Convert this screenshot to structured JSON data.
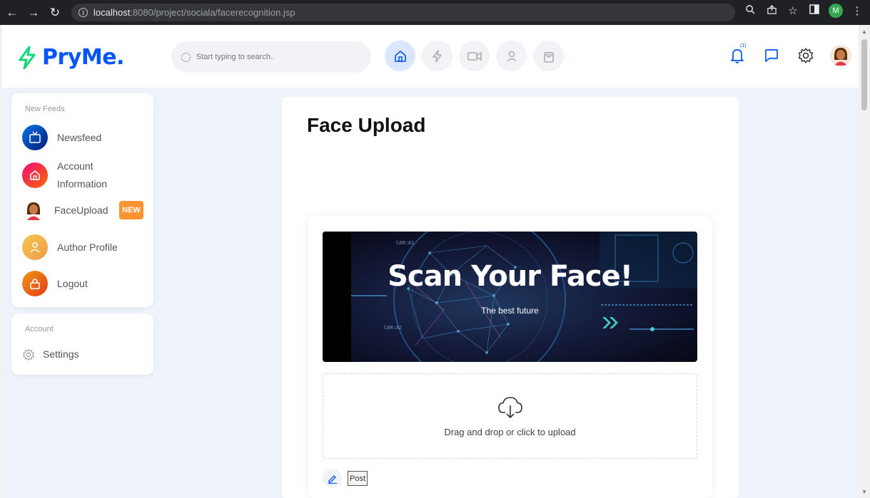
{
  "browser": {
    "url_host": "localhost",
    "url_path": ":8080/project/sociala/facerecognition.jsp",
    "profile_initial": "M",
    "icons": [
      "back-icon",
      "forward-icon",
      "reload-icon",
      "zoom-icon",
      "share-icon",
      "star-icon",
      "sidepanel-icon",
      "menu-icon"
    ]
  },
  "header": {
    "logo_text": "PryMe.",
    "search_placeholder": "Start typing to search..",
    "nav_icons": [
      "home-icon",
      "bolt-icon",
      "video-icon",
      "user-icon",
      "bag-icon"
    ],
    "notification_count": "(1)"
  },
  "sidebar": {
    "section1_title": "New Feeds",
    "items": [
      {
        "label": "Newsfeed",
        "icon": "tv-icon",
        "color": "#0055ff"
      },
      {
        "label": "Account",
        "label2": "Information",
        "icon": "home-icon",
        "color": "#ee0979"
      },
      {
        "label": "FaceUpload",
        "icon": "face-avatar-icon"
      },
      {
        "label": "Author Profile",
        "icon": "user-icon",
        "color": "#f2994a"
      },
      {
        "label": "Logout",
        "icon": "lock-icon",
        "color": "#e44d26"
      }
    ],
    "new_badge": "NEW",
    "section2_title": "Account",
    "settings_label": "Settings"
  },
  "main": {
    "title": "Face Upload",
    "banner_title": "Scan Your Face!",
    "banner_subtitle": "The best future",
    "drop_text": "Drag and drop or click to upload",
    "post_label": "Post"
  },
  "colors": {
    "brand_blue": "#0055ff",
    "brand_green": "#10d876",
    "page_bg": "#eef3fb",
    "badge_orange": "#fe9431"
  }
}
